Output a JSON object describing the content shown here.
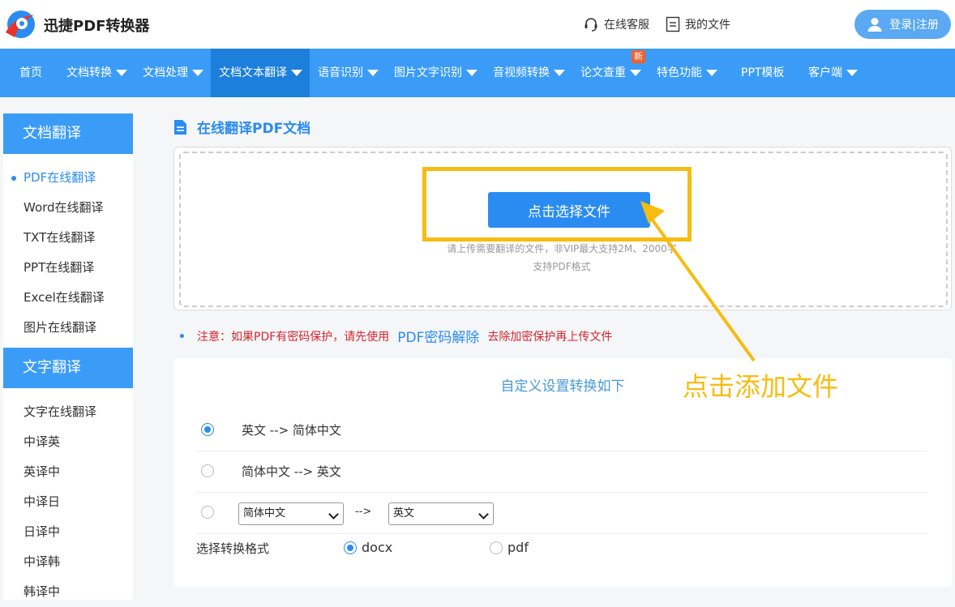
{
  "header": {
    "brand": "迅捷PDF转换器",
    "service": "在线客服",
    "my_files": "我的文件",
    "login": "登录|注册"
  },
  "nav": {
    "items": [
      {
        "label": "首页",
        "caret": false
      },
      {
        "label": "文档转换",
        "caret": true
      },
      {
        "label": "文档处理",
        "caret": true
      },
      {
        "label": "文档文本翻译",
        "caret": true
      },
      {
        "label": "语音识别",
        "caret": true
      },
      {
        "label": "图片文字识别",
        "caret": true
      },
      {
        "label": "音视频转换",
        "caret": true
      },
      {
        "label": "论文查重",
        "caret": true
      },
      {
        "label": "特色功能",
        "caret": true
      },
      {
        "label": "PPT模板",
        "caret": false
      },
      {
        "label": "客户端",
        "caret": true
      }
    ],
    "badge": "新"
  },
  "sidebar": {
    "doc_head": "文档翻译",
    "doc_items": [
      "PDF在线翻译",
      "Word在线翻译",
      "TXT在线翻译",
      "PPT在线翻译",
      "Excel在线翻译",
      "图片在线翻译"
    ],
    "text_head": "文字翻译",
    "text_items": [
      "文字在线翻译",
      "中译英",
      "英译中",
      "中译日",
      "日译中",
      "中译韩",
      "韩译中"
    ]
  },
  "main": {
    "title": "在线翻译PDF文档",
    "upload_button": "点击选择文件",
    "hint_line1": "请上传需要翻译的文件，非VIP最大支持2M、2000字",
    "hint_line2": "支持PDF格式",
    "notice_prefix": "注意：如果PDF有密码保护，请先使用",
    "notice_link": "PDF密码解除",
    "notice_suffix": "去除加密保护再上传文件",
    "settings_title": "自定义设置转换如下",
    "option1": "英文 --> 简体中文",
    "option2": "简体中文 --> 英文",
    "source_lang": "简体中文",
    "arrow": "-->",
    "target_lang": "英文",
    "format_label": "选择转换格式",
    "format_docx": "docx",
    "format_pdf": "pdf"
  },
  "annotation": {
    "text": "点击添加文件",
    "color": "#f7bc12"
  },
  "colors": {
    "primary": "#3b9cf7",
    "nav_active": "#1c7fdc",
    "notice": "#d9252d",
    "badge": "#f0612a"
  }
}
